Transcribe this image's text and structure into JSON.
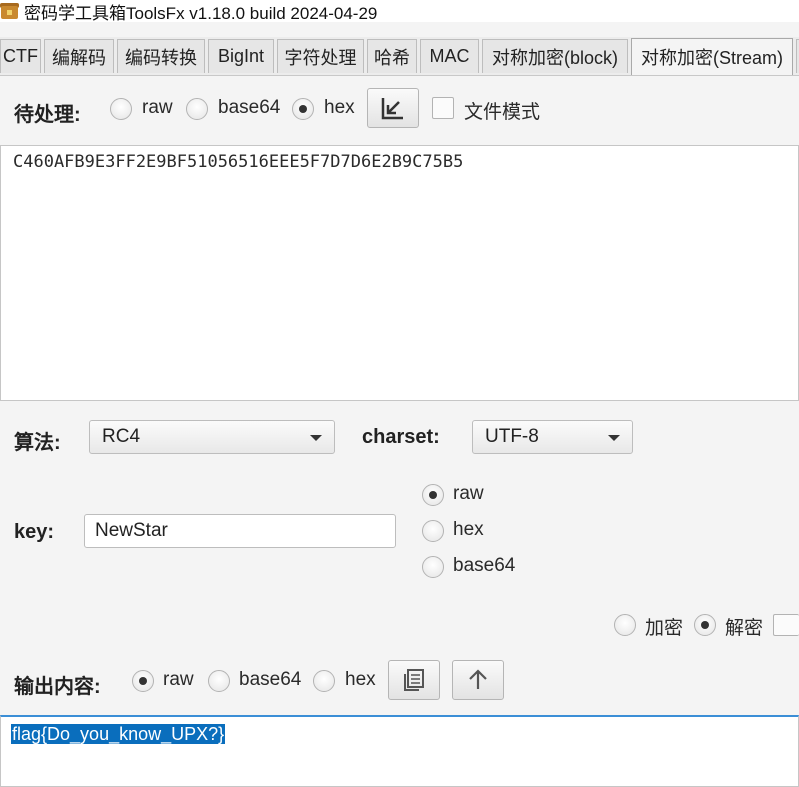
{
  "window": {
    "title": "密码学工具箱ToolsFx v1.18.0 build 2024-04-29",
    "icon": "toolbox-icon"
  },
  "tabs": [
    {
      "label": "CTF"
    },
    {
      "label": "编解码"
    },
    {
      "label": "编码转换"
    },
    {
      "label": "BigInt"
    },
    {
      "label": "字符处理"
    },
    {
      "label": "哈希"
    },
    {
      "label": "MAC"
    },
    {
      "label": "对称加密(block)"
    },
    {
      "label": "对称加密(Stream)",
      "active": true
    }
  ],
  "input": {
    "label": "待处理:",
    "encodings": [
      {
        "label": "raw",
        "selected": false
      },
      {
        "label": "base64",
        "selected": false
      },
      {
        "label": "hex",
        "selected": true
      }
    ],
    "import_button_icon": "import-arrow-icon",
    "file_mode_label": "文件模式",
    "file_mode_checked": false,
    "text": "C460AFB9E3FF2E9BF51056516EEE5F7D7D6E2B9C75B5"
  },
  "algorithm": {
    "label": "算法:",
    "value": "RC4"
  },
  "charset": {
    "label": "charset:",
    "value": "UTF-8"
  },
  "key": {
    "label": "key:",
    "value": "NewStar",
    "encodings": [
      {
        "label": "raw",
        "selected": true
      },
      {
        "label": "hex",
        "selected": false
      },
      {
        "label": "base64",
        "selected": false
      }
    ]
  },
  "mode": {
    "encrypt_label": "加密",
    "encrypt_selected": false,
    "decrypt_label": "解密",
    "decrypt_selected": true
  },
  "output": {
    "label": "输出内容:",
    "encodings": [
      {
        "label": "raw",
        "selected": true
      },
      {
        "label": "base64",
        "selected": false
      },
      {
        "label": "hex",
        "selected": false
      }
    ],
    "copy_button_icon": "copy-icon",
    "up_button_icon": "arrow-up-icon",
    "text": "flag{Do_you_know_UPX?}"
  },
  "colors": {
    "selection": "#0a6ebd",
    "background": "#f4f4f4"
  }
}
